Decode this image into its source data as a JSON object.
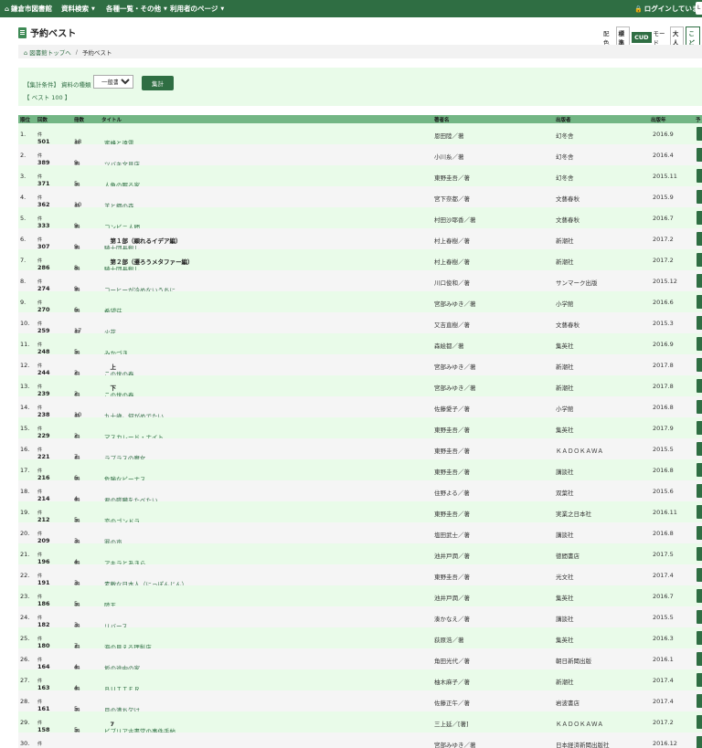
{
  "nav": {
    "home": "鎌倉市図書館",
    "items": [
      "資料検索",
      "各種一覧・その他",
      "利用者のページ"
    ],
    "login_status": "ログインしています",
    "edge_text": "L"
  },
  "page": {
    "title": "予約ベスト"
  },
  "display": {
    "label": "配色",
    "buttons": [
      "標準",
      "CUD",
      "モード",
      "大人",
      "こど"
    ]
  },
  "breadcrumb": {
    "home": "図書館トップへ",
    "separator": "/",
    "current": "予約ベスト"
  },
  "conditions": {
    "label": "【集計条件】",
    "type_label": "資料の種類",
    "type_value": "一般書",
    "submit": "集計",
    "best_label": "【 ベスト 100 】"
  },
  "table": {
    "headers": {
      "rank": "順位",
      "count": "回数",
      "copies": "冊数",
      "title": "タイトル",
      "author": "著者名",
      "publisher": "出版者",
      "year": "出版年",
      "reserve": "予"
    },
    "count_unit": "件",
    "copies_unit": "冊",
    "rows": [
      {
        "rank": "1.",
        "count": "501",
        "copies": "18",
        "title": "蜜蜂と遠雷",
        "author": "恩田陸／著",
        "publisher": "幻冬舎",
        "year": "2016.9"
      },
      {
        "rank": "2.",
        "count": "389",
        "copies": "9",
        "title": "ツバキ文具店",
        "author": "小川糸／著",
        "publisher": "幻冬舎",
        "year": "2016.4"
      },
      {
        "rank": "3.",
        "count": "371",
        "copies": "5",
        "title": "人魚の眠る家",
        "author": "東野圭吾／著",
        "publisher": "幻冬舎",
        "year": "2015.11"
      },
      {
        "rank": "4.",
        "count": "362",
        "copies": "10",
        "title": "羊と鋼の森",
        "author": "宮下奈都／著",
        "publisher": "文藝春秋",
        "year": "2015.9"
      },
      {
        "rank": "5.",
        "count": "333",
        "copies": "9",
        "title": "コンビニ人間",
        "author": "村田沙耶香／著",
        "publisher": "文藝春秋",
        "year": "2016.7"
      },
      {
        "rank": "6.",
        "count": "307",
        "copies": "9",
        "title": "騎士団長殺し",
        "title_sub": "第１部（顕れるイデア編）",
        "author": "村上春樹／著",
        "publisher": "新潮社",
        "year": "2017.2"
      },
      {
        "rank": "7.",
        "count": "286",
        "copies": "8",
        "title": "騎士団長殺し",
        "title_sub": "第２部（遷ろうメタファー編）",
        "author": "村上春樹／著",
        "publisher": "新潮社",
        "year": "2017.2"
      },
      {
        "rank": "8.",
        "count": "274",
        "copies": "9",
        "title": "コーヒーが冷めないうちに",
        "author": "川口俊和／著",
        "publisher": "サンマーク出版",
        "year": "2015.12"
      },
      {
        "rank": "9.",
        "count": "270",
        "copies": "6",
        "title": "希望荘",
        "author": "宮部みゆき／著",
        "publisher": "小学館",
        "year": "2016.6"
      },
      {
        "rank": "10.",
        "count": "259",
        "copies": "17",
        "title": "火花",
        "author": "又吉直樹／著",
        "publisher": "文藝春秋",
        "year": "2015.3"
      },
      {
        "rank": "11.",
        "count": "248",
        "copies": "5",
        "title": "みかづき",
        "author": "森絵都／著",
        "publisher": "集英社",
        "year": "2016.9"
      },
      {
        "rank": "12.",
        "count": "244",
        "copies": "2",
        "title": "この世の春",
        "title_sub": "上",
        "author": "宮部みゆき／著",
        "publisher": "新潮社",
        "year": "2017.8"
      },
      {
        "rank": "13.",
        "count": "239",
        "copies": "2",
        "title": "この世の春",
        "title_sub": "下",
        "author": "宮部みゆき／著",
        "publisher": "新潮社",
        "year": "2017.8"
      },
      {
        "rank": "14.",
        "count": "238",
        "copies": "10",
        "title": "九十歳。何がめでたい",
        "author": "佐藤愛子／著",
        "publisher": "小学館",
        "year": "2016.8"
      },
      {
        "rank": "15.",
        "count": "229",
        "copies": "2",
        "title": "マスカレード・ナイト",
        "author": "東野圭吾／著",
        "publisher": "集英社",
        "year": "2017.9"
      },
      {
        "rank": "16.",
        "count": "221",
        "copies": "7",
        "title": "ラプラスの魔女",
        "author": "東野圭吾／著",
        "publisher": "ＫＡＤＯＫＡＷＡ",
        "year": "2015.5"
      },
      {
        "rank": "17.",
        "count": "216",
        "copies": "6",
        "title": "危険なビーナス",
        "author": "東野圭吾／著",
        "publisher": "講談社",
        "year": "2016.8"
      },
      {
        "rank": "18.",
        "count": "214",
        "copies": "4",
        "title": "君の膵臓をたべたい",
        "author": "住野よる／著",
        "publisher": "双葉社",
        "year": "2015.6"
      },
      {
        "rank": "19.",
        "count": "212",
        "copies": "5",
        "title": "恋のゴンドラ",
        "author": "東野圭吾／著",
        "publisher": "実業之日本社",
        "year": "2016.11"
      },
      {
        "rank": "20.",
        "count": "209",
        "copies": "3",
        "title": "罪の声",
        "author": "塩田武士／著",
        "publisher": "講談社",
        "year": "2016.8"
      },
      {
        "rank": "21.",
        "count": "196",
        "copies": "4",
        "title": "アキラとあきら",
        "author": "池井戸潤／著",
        "publisher": "徳間書店",
        "year": "2017.5"
      },
      {
        "rank": "22.",
        "count": "191",
        "copies": "3",
        "title": "素敵な日本人（にっぽんじん）",
        "author": "東野圭吾／著",
        "publisher": "光文社",
        "year": "2017.4"
      },
      {
        "rank": "23.",
        "count": "186",
        "copies": "5",
        "title": "陸王",
        "author": "池井戸潤／著",
        "publisher": "集英社",
        "year": "2016.7"
      },
      {
        "rank": "24.",
        "count": "182",
        "copies": "3",
        "title": "リバース",
        "author": "湊かなえ／著",
        "publisher": "講談社",
        "year": "2015.5"
      },
      {
        "rank": "25.",
        "count": "180",
        "copies": "7",
        "title": "海の見える理髪店",
        "author": "荻原浩／著",
        "publisher": "集英社",
        "year": "2016.3"
      },
      {
        "rank": "26.",
        "count": "164",
        "copies": "4",
        "title": "坂の途中の家",
        "author": "角田光代／著",
        "publisher": "朝日新聞出版",
        "year": "2016.1"
      },
      {
        "rank": "27.",
        "count": "163",
        "copies": "4",
        "title": "ＢＵＴＴＥＲ",
        "author": "柚木麻子／著",
        "publisher": "新潮社",
        "year": "2017.4"
      },
      {
        "rank": "28.",
        "count": "161",
        "copies": "5",
        "title": "月の満ち欠け",
        "author": "佐藤正午／著",
        "publisher": "岩波書店",
        "year": "2017.4"
      },
      {
        "rank": "29.",
        "count": "158",
        "copies": "5",
        "title": "ビブリア古書堂の事件手帖",
        "title_sub": "7",
        "author": "三上延／[著]",
        "publisher": "ＫＡＤＯＫＡＷＡ",
        "year": "2017.2"
      },
      {
        "rank": "30.",
        "count": "155",
        "copies": "4",
        "title": "三鬼",
        "author": "宮部みゆき／著",
        "publisher": "日本経済新聞出版社",
        "year": "2016.12"
      }
    ]
  }
}
